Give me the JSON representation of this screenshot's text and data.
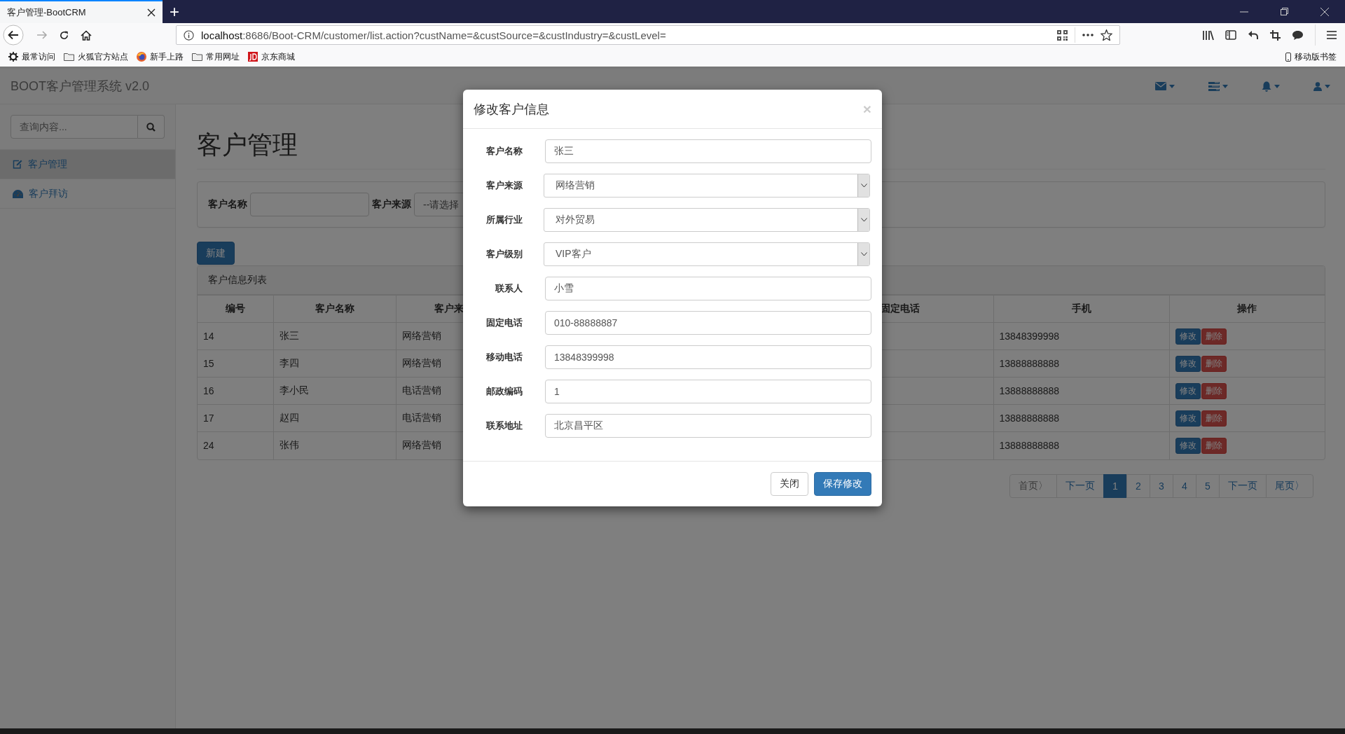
{
  "browser": {
    "tab": {
      "title": "客户管理-BootCRM",
      "selected": true
    },
    "new_tab": "+",
    "address": {
      "host": "localhost",
      "path": ":8686/Boot-CRM/customer/list.action?custName=&custSource=&custIndustry=&custLevel="
    },
    "bookmarks": [
      {
        "label": "最常访问",
        "kind": "gear"
      },
      {
        "label": "火狐官方站点",
        "kind": "folder"
      },
      {
        "label": "新手上路",
        "kind": "firefox"
      },
      {
        "label": "常用网址",
        "kind": "folder"
      },
      {
        "label": "京东商城",
        "kind": "jd"
      }
    ],
    "mobile_bookmarks": "移动版书签"
  },
  "app": {
    "brand": "BOOT客户管理系统 v2.0",
    "search": {
      "placeholder": "查询内容..."
    },
    "sidebar": [
      {
        "label": "客户管理",
        "kind": "edit",
        "selected": true
      },
      {
        "label": "客户拜访",
        "kind": "dashboard",
        "selected": false
      }
    ],
    "page_title": "客户管理",
    "filter": {
      "name_label": "客户名称",
      "source_label": "客户来源",
      "source_select": "--请选择"
    },
    "new_button": "新建",
    "panel_title": "客户信息列表",
    "columns": [
      "编号",
      "客户名称",
      "客户来",
      "固定电话",
      "手机",
      "操作"
    ],
    "rows": [
      {
        "id": "14",
        "name": "张三",
        "source": "网络营销",
        "mobile": "13848399998",
        "actions": [
          {
            "label": "修改",
            "kind": "edit"
          },
          {
            "label": "删除",
            "kind": "delete"
          }
        ]
      },
      {
        "id": "15",
        "name": "李四",
        "source": "网络营销",
        "mobile": "13888888888",
        "actions": [
          {
            "label": "修改",
            "kind": "edit"
          },
          {
            "label": "删除",
            "kind": "delete"
          }
        ]
      },
      {
        "id": "16",
        "name": "李小民",
        "source": "电话营销",
        "mobile": "13888888888",
        "actions": [
          {
            "label": "修改",
            "kind": "edit"
          },
          {
            "label": "删除",
            "kind": "delete"
          }
        ]
      },
      {
        "id": "17",
        "name": "赵四",
        "source": "电话营销",
        "mobile": "13888888888",
        "actions": [
          {
            "label": "修改",
            "kind": "edit"
          },
          {
            "label": "删除",
            "kind": "delete"
          }
        ]
      },
      {
        "id": "24",
        "name": "张伟",
        "source": "网络营销",
        "mobile": "13888888888",
        "actions": [
          {
            "label": "修改",
            "kind": "edit"
          },
          {
            "label": "删除",
            "kind": "delete"
          }
        ]
      }
    ],
    "pagination": [
      {
        "label": "首页〉",
        "selected": false
      },
      {
        "label": "下一页",
        "selected": false
      },
      {
        "label": "1",
        "selected": true
      },
      {
        "label": "2",
        "selected": false
      },
      {
        "label": "3",
        "selected": false
      },
      {
        "label": "4",
        "selected": false
      },
      {
        "label": "5",
        "selected": false
      },
      {
        "label": "下一页",
        "selected": false
      },
      {
        "label": "尾页〉",
        "selected": false
      }
    ]
  },
  "modal": {
    "title": "修改客户信息",
    "close": "×",
    "fields": [
      {
        "label": "客户名称",
        "kind": "text",
        "value": "张三"
      },
      {
        "label": "客户来源",
        "kind": "select",
        "value": "网络营销"
      },
      {
        "label": "所属行业",
        "kind": "select",
        "value": "对外贸易"
      },
      {
        "label": "客户级别",
        "kind": "select",
        "value": "VIP客户"
      },
      {
        "label": "联系人",
        "kind": "text",
        "value": "小雪"
      },
      {
        "label": "固定电话",
        "kind": "text",
        "value": "010-88888887"
      },
      {
        "label": "移动电话",
        "kind": "text",
        "value": "13848399998"
      },
      {
        "label": "邮政编码",
        "kind": "text",
        "value": "1"
      },
      {
        "label": "联系地址",
        "kind": "text",
        "value": "北京昌平区"
      }
    ],
    "buttons": [
      {
        "label": "关闭",
        "kind": "default"
      },
      {
        "label": "保存修改",
        "kind": "primary"
      }
    ]
  }
}
